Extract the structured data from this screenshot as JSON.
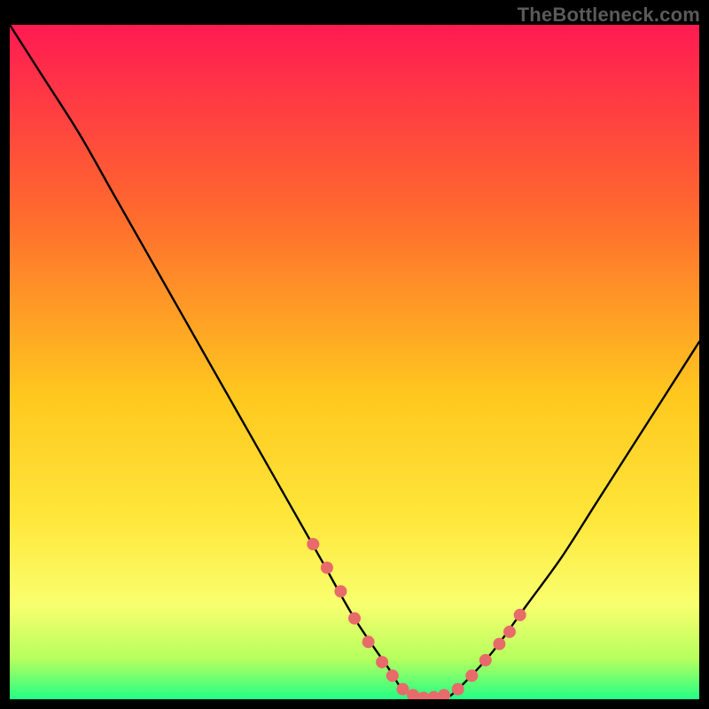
{
  "watermark": "TheBottleneck.com",
  "colors": {
    "background": "#000000",
    "gradient_top": "#ff1a52",
    "gradient_mid1": "#ff6a2e",
    "gradient_mid2": "#ffc81f",
    "gradient_mid3": "#ffe63a",
    "gradient_mid35": "#f9ff6e",
    "gradient_mid4": "#b6ff5e",
    "gradient_bottom": "#24ff85",
    "curve": "#000000",
    "dots": "#e86a6a"
  },
  "chart_data": {
    "type": "line",
    "title": "",
    "xlabel": "",
    "ylabel": "",
    "xlim": [
      0,
      100
    ],
    "ylim": [
      0,
      100
    ],
    "series": [
      {
        "name": "bottleneck-curve",
        "x": [
          0,
          5,
          10,
          15,
          20,
          25,
          30,
          35,
          40,
          45,
          50,
          55,
          57,
          60,
          63,
          65,
          70,
          75,
          80,
          85,
          90,
          95,
          100
        ],
        "y": [
          100,
          92,
          84,
          75,
          66,
          57,
          48,
          39,
          30,
          21,
          12,
          4.5,
          1.5,
          0.2,
          0.2,
          1.5,
          7,
          14,
          21,
          29,
          37,
          45,
          53
        ]
      }
    ],
    "highlight_points": {
      "name": "optimal-range-dots",
      "x": [
        44,
        46,
        48,
        50,
        52,
        54,
        55.5,
        57,
        58.5,
        60,
        61.5,
        63,
        65,
        67,
        69,
        71,
        72.5,
        74
      ],
      "y": [
        23,
        19.5,
        16,
        12,
        8.5,
        5.5,
        3.5,
        1.5,
        0.6,
        0.2,
        0.3,
        0.6,
        1.5,
        3.5,
        5.8,
        8.2,
        10,
        12.5
      ]
    }
  }
}
